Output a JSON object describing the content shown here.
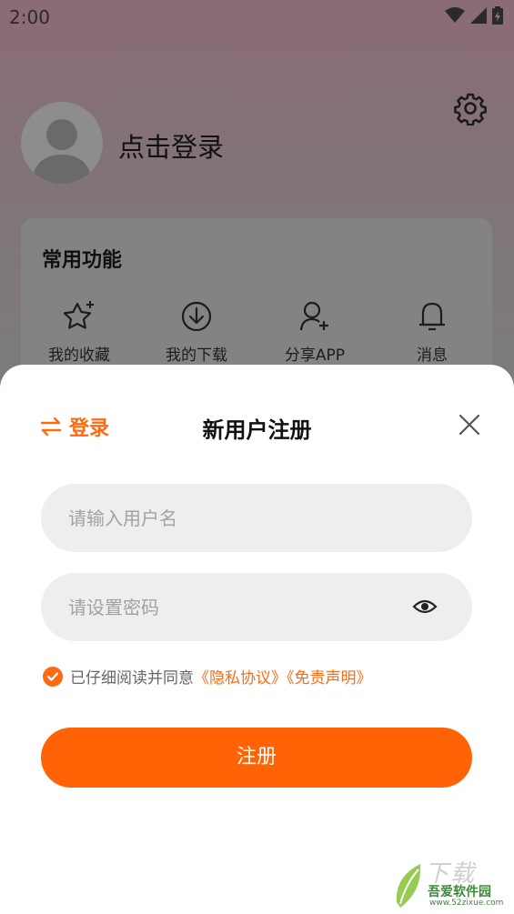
{
  "status_bar": {
    "time": "2:00"
  },
  "profile": {
    "login_prompt": "点击登录"
  },
  "functions": {
    "title": "常用功能",
    "items": [
      {
        "label": "我的收藏",
        "icon": "star-icon"
      },
      {
        "label": "我的下载",
        "icon": "download-icon"
      },
      {
        "label": "分享APP",
        "icon": "add-user-icon"
      },
      {
        "label": "消息",
        "icon": "bell-icon"
      }
    ]
  },
  "sheet": {
    "switch_label": "登录",
    "title": "新用户注册",
    "username_placeholder": "请输入用户名",
    "password_placeholder": "请设置密码",
    "agree_text": "已仔细阅读并同意",
    "privacy_link": "《隐私协议》",
    "disclaimer_link": "《免责声明》",
    "submit_label": "注册"
  },
  "watermark": {
    "brand": "吾爱软件园",
    "url": "www.52zixue.com",
    "mark": "下载"
  },
  "colors": {
    "accent": "#ff6306",
    "overlay": "#7c7c7c"
  }
}
